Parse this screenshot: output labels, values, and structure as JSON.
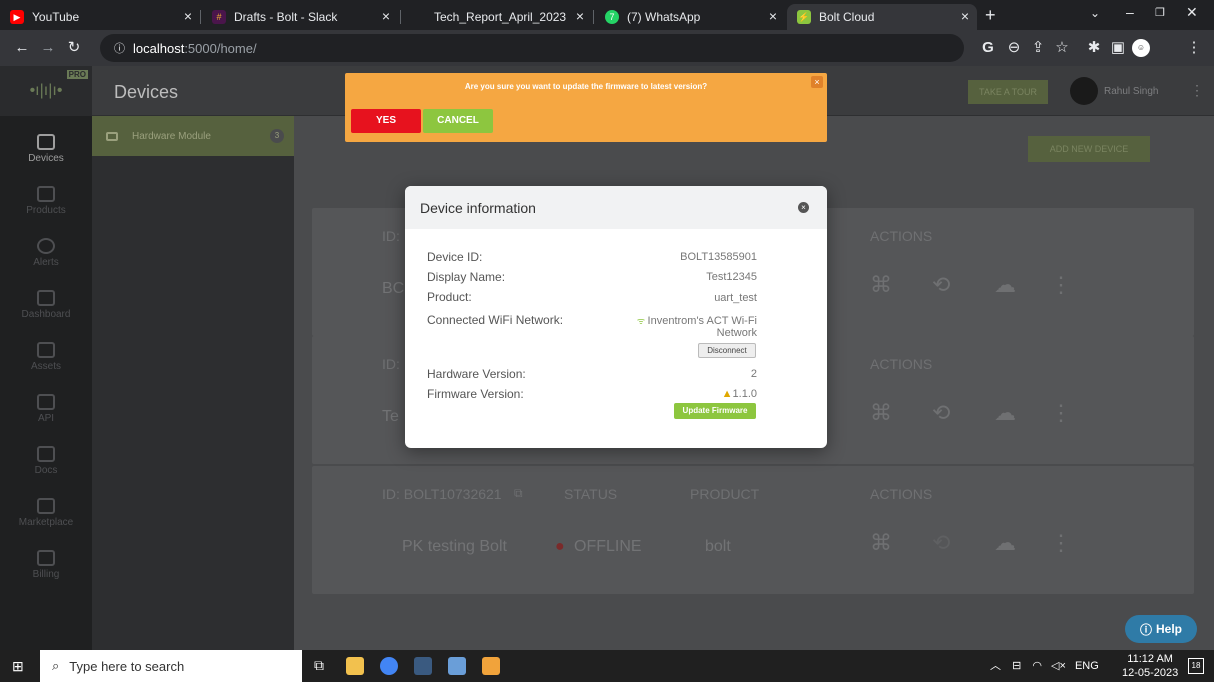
{
  "browser": {
    "tabs": [
      {
        "label": "YouTube",
        "favicon": "youtube-icon",
        "color": "#ff0000"
      },
      {
        "label": "Drafts - Bolt - Slack",
        "favicon": "slack-icon",
        "color": "#e01e5a"
      },
      {
        "label": "Tech_Report_April_2023",
        "favicon": "apple-icon",
        "color": "#9aa0a6"
      },
      {
        "label": "(7) WhatsApp",
        "favicon": "whatsapp-icon",
        "color": "#25d366"
      },
      {
        "label": "Bolt Cloud",
        "favicon": "bolt-icon",
        "color": "#8dc63f"
      }
    ],
    "url_host": "localhost",
    "url_path": ":5000/home/"
  },
  "app": {
    "title": "Devices",
    "logo_badge": "PRO",
    "take_tour": "TAKE A TOUR",
    "user_name": "Rahul Singh",
    "add_device": "ADD NEW DEVICE"
  },
  "sidebar": {
    "items": [
      {
        "label": "Devices",
        "icon": "chip-icon"
      },
      {
        "label": "Products",
        "icon": "products-icon"
      },
      {
        "label": "Alerts",
        "icon": "alerts-icon"
      },
      {
        "label": "Dashboard",
        "icon": "dashboard-icon"
      },
      {
        "label": "Assets",
        "icon": "assets-icon"
      },
      {
        "label": "API",
        "icon": "api-icon"
      },
      {
        "label": "Docs",
        "icon": "docs-icon"
      },
      {
        "label": "Marketplace",
        "icon": "marketplace-icon"
      },
      {
        "label": "Billing",
        "icon": "billing-icon"
      }
    ]
  },
  "device_list": {
    "item_label": "Hardware Module",
    "count": "3"
  },
  "cards": [
    {
      "id": "ID:",
      "name": "BC",
      "status": "",
      "product": ""
    },
    {
      "id": "ID:",
      "name": "Te",
      "status": "",
      "product": ""
    },
    {
      "id": "ID: BOLT10732621",
      "name": "PK testing Bolt",
      "status": "OFFLINE",
      "product": "bolt"
    }
  ],
  "card_headers": {
    "status": "STATUS",
    "product": "PRODUCT",
    "actions": "ACTIONS"
  },
  "alert": {
    "message": "Are you sure you want to update the firmware to latest version?",
    "yes_label": "YES",
    "cancel_label": "CANCEL",
    "close": "×"
  },
  "modal": {
    "title": "Device information",
    "rows": {
      "device_id_label": "Device ID:",
      "device_id": "BOLT13585901",
      "display_name_label": "Display Name:",
      "display_name": "Test12345",
      "product_label": "Product:",
      "product": "uart_test",
      "wifi_label": "Connected WiFi Network:",
      "wifi_line1": "Inventrom's ACT Wi-Fi",
      "wifi_line2": "Network",
      "disconnect": "Disconnect",
      "hw_label": "Hardware Version:",
      "hw": "2",
      "fw_label": "Firmware Version:",
      "fw": "1.1.0",
      "update_fw": "Update Firmware"
    }
  },
  "help": "Help",
  "taskbar": {
    "search_placeholder": "Type here to search",
    "tray_lang": "ENG",
    "time": "11:12 AM",
    "date": "12-05-2023",
    "notif_count": "18"
  }
}
